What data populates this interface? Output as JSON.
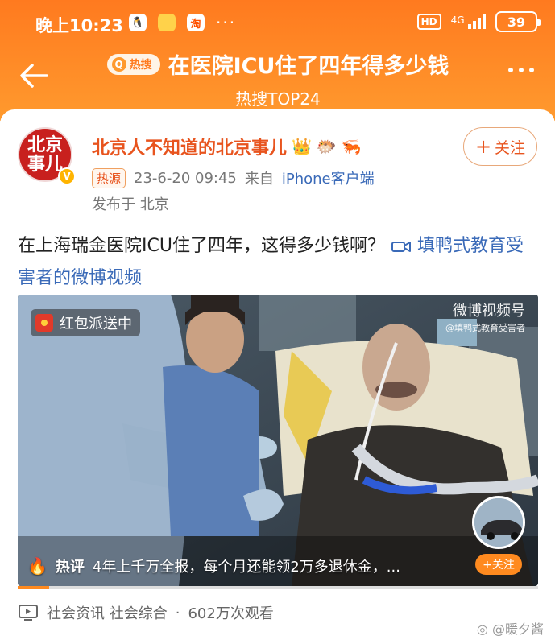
{
  "status": {
    "time": "晚上10:23",
    "hd": "HD",
    "network": "4G",
    "battery": "39"
  },
  "header": {
    "hot_pill": "热搜",
    "title": "在医院ICU住了四年得多少钱",
    "subtitle": "热搜TOP24"
  },
  "post": {
    "avatar_text_1": "北京",
    "avatar_text_2": "事儿",
    "username": "北京人不知道的北京事儿",
    "source_tag": "热源",
    "datetime": "23-6-20 09:45",
    "from_label": "来自",
    "device": "iPhone客户端",
    "location": "发布于 北京",
    "follow_label": "关注",
    "text": "在上海瑞金医院ICU住了四年，这得多少钱啊？",
    "link_text": "填鸭式教育受害者的微博视频"
  },
  "video": {
    "red_packet": "红包派送中",
    "watermark_main": "微博视频号",
    "watermark_sub": "@填鸭式教育受害者",
    "hot_label": "热评",
    "hot_text": "4年上千万全报，每个月还能领2万多退休金，...",
    "follow_small": "+关注",
    "progress": 0.06
  },
  "footer": {
    "category": "社会资讯 社会综合",
    "views": "602万次观看",
    "watermark": "暖夕酱"
  },
  "colors": {
    "header_orange": "#ff7a1f",
    "accent": "#e8541e",
    "link": "#3a6ab8"
  }
}
